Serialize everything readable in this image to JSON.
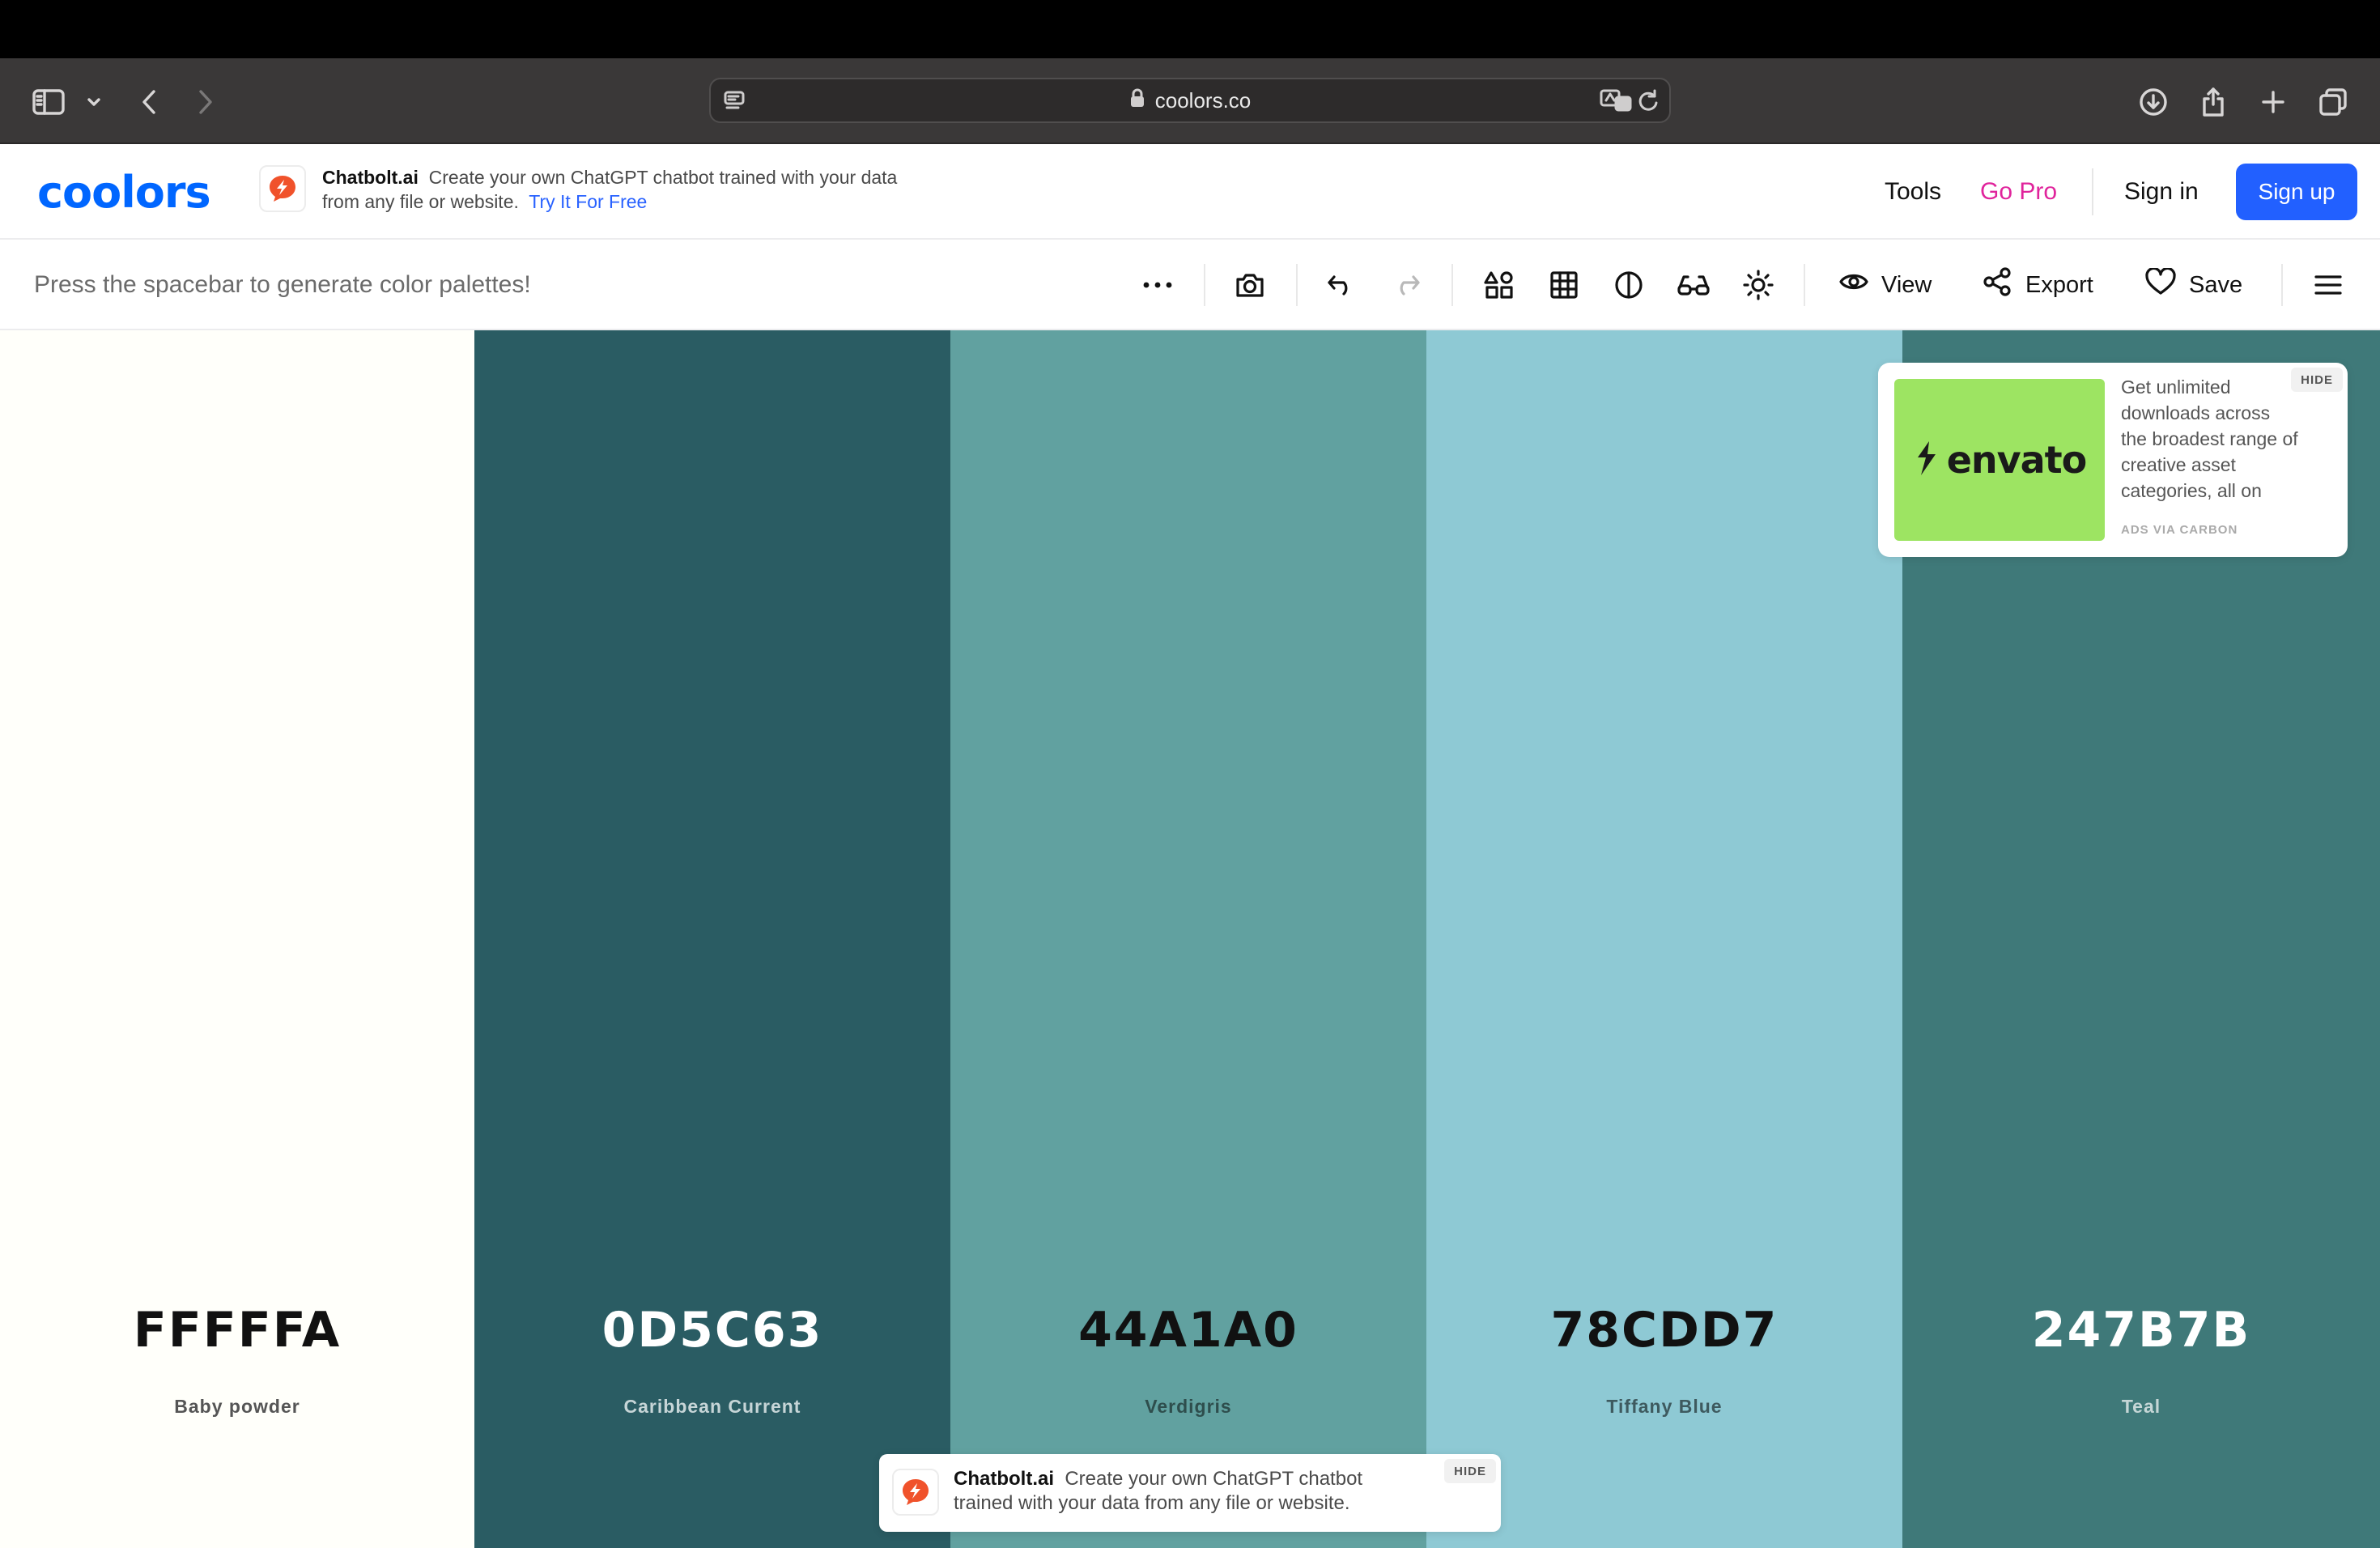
{
  "browser": {
    "url": "coolors.co",
    "icons": [
      "sidebar-icon",
      "chevron-down-icon",
      "back-icon",
      "forward-icon",
      "page-icon",
      "lock-icon",
      "translate-icon",
      "reload-icon",
      "download-icon",
      "share-icon",
      "plus-icon",
      "tabs-icon"
    ]
  },
  "header": {
    "logo": "coolors",
    "promo": {
      "brand": "Chatbolt.ai",
      "text": "Create your own ChatGPT chatbot trained with your data from any file or website.",
      "cta": "Try It For Free"
    },
    "nav": {
      "tools": "Tools",
      "gopro": "Go Pro",
      "signin": "Sign in",
      "signup": "Sign up"
    }
  },
  "toolbar": {
    "hint": "Press the spacebar to generate color palettes!",
    "view": "View",
    "export": "Export",
    "save": "Save"
  },
  "palette": [
    {
      "hex": "FFFFFA",
      "name": "Baby powder",
      "color": "#FFFFFA",
      "text_color": "#111111",
      "name_color": "#555555"
    },
    {
      "hex": "0D5C63",
      "name": "Caribbean Current",
      "color": "#2A5C63",
      "text_color": "#FFFFFF",
      "name_color": "#C6D5D7"
    },
    {
      "hex": "44A1A0",
      "name": "Verdigris",
      "color": "#61A1A0",
      "text_color": "#111111",
      "name_color": "#2E4E4D"
    },
    {
      "hex": "78CDD7",
      "name": "Tiffany Blue",
      "color": "#8EC9D4",
      "text_color": "#111111",
      "name_color": "#3E5A5F"
    },
    {
      "hex": "247B7B",
      "name": "Teal",
      "color": "#3F7979",
      "text_color": "#FFFFFF",
      "name_color": "#C5D6D6"
    }
  ],
  "carbon_ad": {
    "brand": "envato",
    "text": "Get unlimited downloads across the broadest range of creative asset categories, all on",
    "via": "ADS VIA CARBON",
    "hide": "HIDE"
  },
  "bottom_promo": {
    "brand": "Chatbolt.ai",
    "text": "Create your own ChatGPT chatbot trained with your data from any file or website.",
    "hide": "HIDE"
  }
}
